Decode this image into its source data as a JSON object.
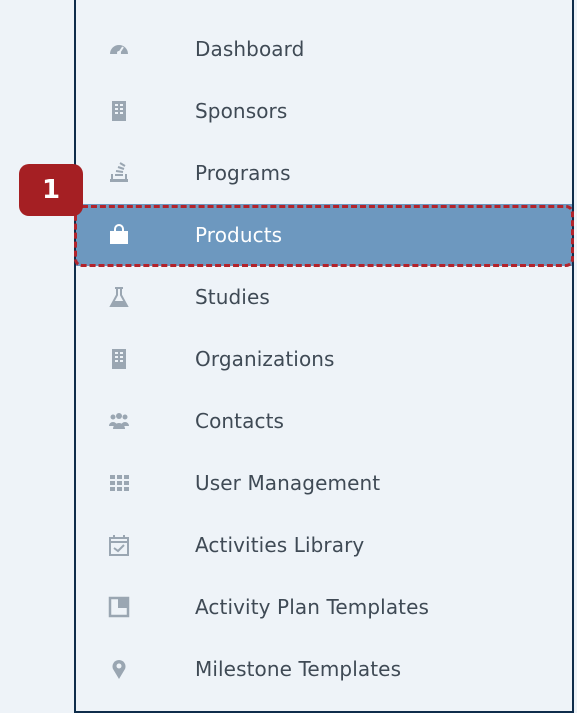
{
  "step_badge": "1",
  "nav": {
    "items": [
      {
        "label": "Dashboard",
        "icon": "dashboard-icon"
      },
      {
        "label": "Sponsors",
        "icon": "building-icon"
      },
      {
        "label": "Programs",
        "icon": "programs-icon"
      },
      {
        "label": "Products",
        "icon": "shopping-bag-icon",
        "active": true
      },
      {
        "label": "Studies",
        "icon": "flask-icon"
      },
      {
        "label": "Organizations",
        "icon": "building-icon"
      },
      {
        "label": "Contacts",
        "icon": "users-icon"
      },
      {
        "label": "User Management",
        "icon": "grid-icon"
      },
      {
        "label": "Activities Library",
        "icon": "calendar-check-icon"
      },
      {
        "label": "Activity Plan Templates",
        "icon": "template-icon"
      },
      {
        "label": "Milestone Templates",
        "icon": "map-pin-icon"
      }
    ]
  },
  "colors": {
    "background": "#eef3f8",
    "active_row": "#6d98bf",
    "highlight": "#b3232b",
    "border": "#0f2d4b"
  }
}
